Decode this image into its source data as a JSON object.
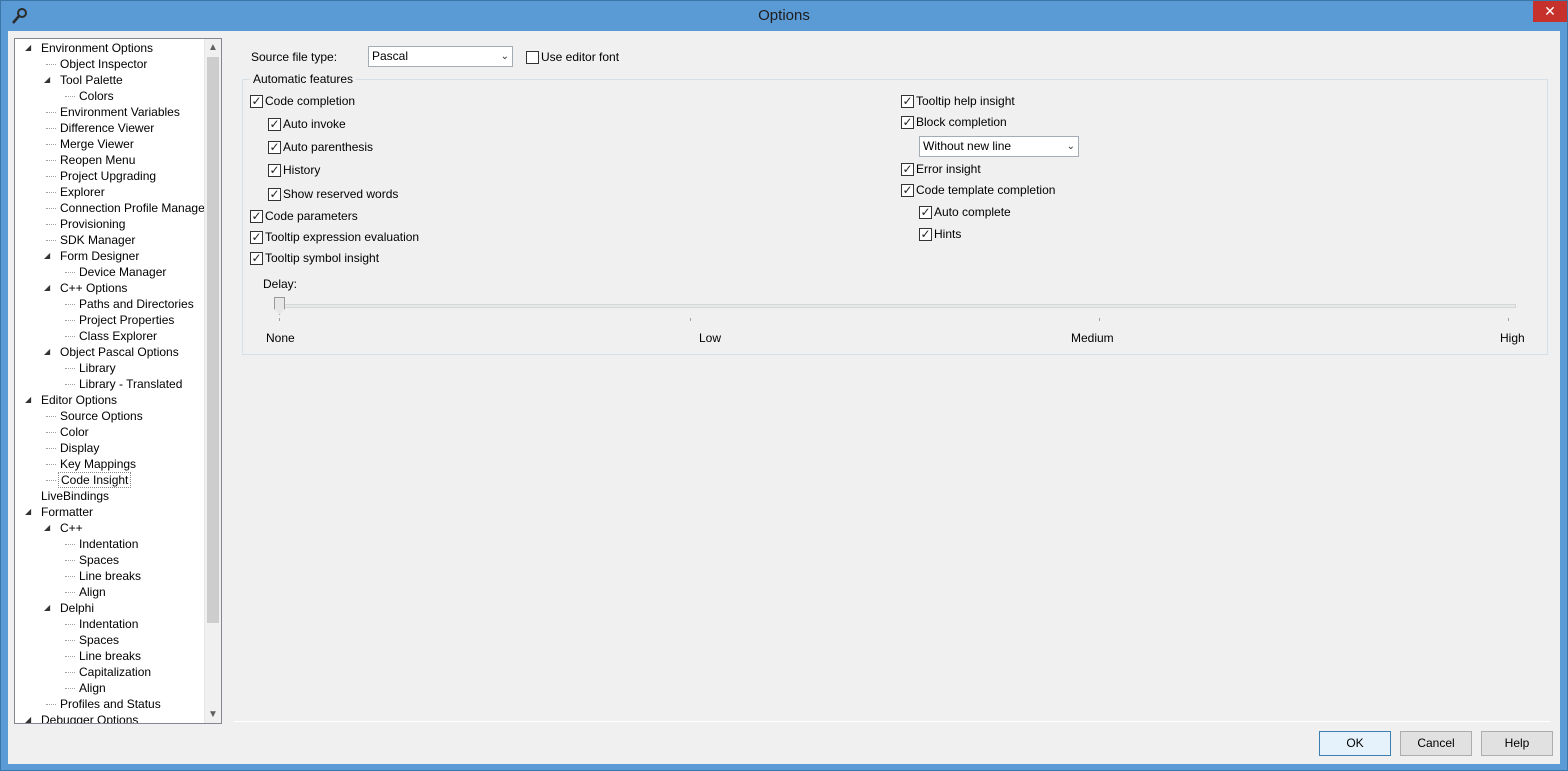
{
  "window": {
    "title": "Options",
    "close_glyph": "✕",
    "icon": "wrench-gear-icon"
  },
  "tree": {
    "items": [
      {
        "label": "Environment Options",
        "level": 0,
        "expanded": true
      },
      {
        "label": "Object Inspector",
        "level": 1
      },
      {
        "label": "Tool Palette",
        "level": 1,
        "expanded": true
      },
      {
        "label": "Colors",
        "level": 2
      },
      {
        "label": "Environment Variables",
        "level": 1
      },
      {
        "label": "Difference Viewer",
        "level": 1
      },
      {
        "label": "Merge Viewer",
        "level": 1
      },
      {
        "label": "Reopen Menu",
        "level": 1
      },
      {
        "label": "Project Upgrading",
        "level": 1
      },
      {
        "label": "Explorer",
        "level": 1
      },
      {
        "label": "Connection Profile Manager",
        "level": 1
      },
      {
        "label": "Provisioning",
        "level": 1
      },
      {
        "label": "SDK Manager",
        "level": 1
      },
      {
        "label": "Form Designer",
        "level": 1,
        "expanded": true
      },
      {
        "label": "Device Manager",
        "level": 2
      },
      {
        "label": "C++ Options",
        "level": 1,
        "expanded": true
      },
      {
        "label": "Paths and Directories",
        "level": 2
      },
      {
        "label": "Project Properties",
        "level": 2
      },
      {
        "label": "Class Explorer",
        "level": 2
      },
      {
        "label": "Object Pascal Options",
        "level": 1,
        "expanded": true
      },
      {
        "label": "Library",
        "level": 2
      },
      {
        "label": "Library - Translated",
        "level": 2
      },
      {
        "label": "Editor Options",
        "level": 0,
        "expanded": true
      },
      {
        "label": "Source Options",
        "level": 1
      },
      {
        "label": "Color",
        "level": 1
      },
      {
        "label": "Display",
        "level": 1
      },
      {
        "label": "Key Mappings",
        "level": 1
      },
      {
        "label": "Code Insight",
        "level": 1,
        "selected": true
      },
      {
        "label": "LiveBindings",
        "level": 0
      },
      {
        "label": "Formatter",
        "level": 0,
        "expanded": true
      },
      {
        "label": "C++",
        "level": 1,
        "expanded": true
      },
      {
        "label": "Indentation",
        "level": 2
      },
      {
        "label": "Spaces",
        "level": 2
      },
      {
        "label": "Line breaks",
        "level": 2
      },
      {
        "label": "Align",
        "level": 2
      },
      {
        "label": "Delphi",
        "level": 1,
        "expanded": true
      },
      {
        "label": "Indentation",
        "level": 2
      },
      {
        "label": "Spaces",
        "level": 2
      },
      {
        "label": "Line breaks",
        "level": 2
      },
      {
        "label": "Capitalization",
        "level": 2
      },
      {
        "label": "Align",
        "level": 2
      },
      {
        "label": "Profiles and Status",
        "level": 1
      },
      {
        "label": "Debugger Options",
        "level": 0,
        "expanded": true
      }
    ]
  },
  "source_file_type": {
    "label": "Source file type:",
    "value": "Pascal"
  },
  "use_editor_font": {
    "label": "Use editor font",
    "checked": false
  },
  "automatic_features": {
    "title": "Automatic features",
    "left": [
      {
        "label": "Code completion",
        "checked": true
      },
      {
        "label": "Auto invoke",
        "checked": true
      },
      {
        "label": "Auto parenthesis",
        "checked": true
      },
      {
        "label": "History",
        "checked": true
      },
      {
        "label": "Show reserved words",
        "checked": true
      },
      {
        "label": "Code parameters",
        "checked": true
      },
      {
        "label": "Tooltip expression evaluation",
        "checked": true
      },
      {
        "label": "Tooltip symbol insight",
        "checked": true
      }
    ],
    "right": [
      {
        "label": "Tooltip help insight",
        "checked": true
      },
      {
        "label": "Block completion",
        "checked": true
      },
      {
        "label": "Error insight",
        "checked": true
      },
      {
        "label": "Code template completion",
        "checked": true
      },
      {
        "label": "Auto complete",
        "checked": true
      },
      {
        "label": "Hints",
        "checked": true
      }
    ],
    "block_completion_mode": "Without new line",
    "delay": {
      "label": "Delay:",
      "ticks": [
        "None",
        "Low",
        "Medium",
        "High"
      ],
      "value_fraction": 0
    }
  },
  "buttons": {
    "ok": "OK",
    "cancel": "Cancel",
    "help": "Help"
  },
  "glyphs": {
    "check": "✓",
    "chevron_down": "⌄",
    "scroll_up": "▲",
    "scroll_down": "▼",
    "expanded": "◢"
  }
}
